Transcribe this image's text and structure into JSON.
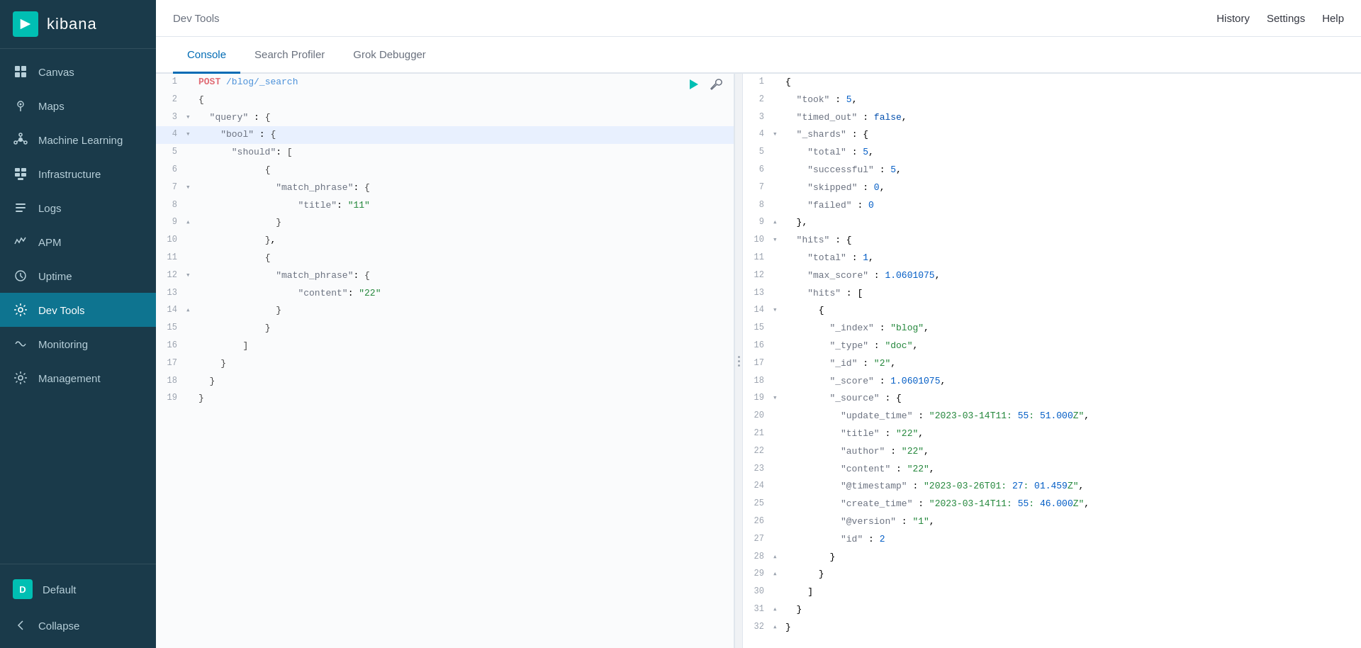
{
  "app": {
    "title": "kibana",
    "page_title": "Dev Tools"
  },
  "topbar": {
    "title": "Dev Tools",
    "actions": [
      "History",
      "Settings",
      "Help"
    ]
  },
  "tabs": [
    {
      "id": "console",
      "label": "Console",
      "active": true
    },
    {
      "id": "search-profiler",
      "label": "Search Profiler",
      "active": false
    },
    {
      "id": "grok-debugger",
      "label": "Grok Debugger",
      "active": false
    }
  ],
  "sidebar": {
    "items": [
      {
        "id": "canvas",
        "label": "Canvas",
        "icon": "⊞"
      },
      {
        "id": "maps",
        "label": "Maps",
        "icon": "◎"
      },
      {
        "id": "machine-learning",
        "label": "Machine Learning",
        "icon": "⚙"
      },
      {
        "id": "infrastructure",
        "label": "Infrastructure",
        "icon": "▦"
      },
      {
        "id": "logs",
        "label": "Logs",
        "icon": "☰"
      },
      {
        "id": "apm",
        "label": "APM",
        "icon": "◈"
      },
      {
        "id": "uptime",
        "label": "Uptime",
        "icon": "♡"
      },
      {
        "id": "dev-tools",
        "label": "Dev Tools",
        "icon": "⌘",
        "active": true
      },
      {
        "id": "monitoring",
        "label": "Monitoring",
        "icon": "♡"
      },
      {
        "id": "management",
        "label": "Management",
        "icon": "⚙"
      }
    ],
    "user": {
      "label": "Default",
      "initial": "D"
    },
    "collapse": "Collapse"
  },
  "query": {
    "lines": [
      {
        "num": 1,
        "fold": "",
        "content": "POST /blog/_search",
        "type": "header",
        "highlight": false
      },
      {
        "num": 2,
        "fold": "",
        "content": "{",
        "type": "bracket",
        "highlight": false
      },
      {
        "num": 3,
        "fold": "▾",
        "content": "  \"query\" : {",
        "type": "code",
        "highlight": false
      },
      {
        "num": 4,
        "fold": "▾",
        "content": "    \"bool\" : {",
        "type": "code",
        "highlight": true
      },
      {
        "num": 5,
        "fold": "",
        "content": "      \"should\": [",
        "type": "code",
        "highlight": false
      },
      {
        "num": 6,
        "fold": "",
        "content": "            {",
        "type": "code",
        "highlight": false
      },
      {
        "num": 7,
        "fold": "▾",
        "content": "              \"match_phrase\": {",
        "type": "code",
        "highlight": false
      },
      {
        "num": 8,
        "fold": "",
        "content": "                  \"title\": \"11\"",
        "type": "code",
        "highlight": false
      },
      {
        "num": 9,
        "fold": "▴",
        "content": "              }",
        "type": "code",
        "highlight": false
      },
      {
        "num": 10,
        "fold": "",
        "content": "            },",
        "type": "code",
        "highlight": false
      },
      {
        "num": 11,
        "fold": "",
        "content": "            {",
        "type": "code",
        "highlight": false
      },
      {
        "num": 12,
        "fold": "▾",
        "content": "              \"match_phrase\": {",
        "type": "code",
        "highlight": false
      },
      {
        "num": 13,
        "fold": "",
        "content": "                  \"content\": \"22\"",
        "type": "code",
        "highlight": false
      },
      {
        "num": 14,
        "fold": "▴",
        "content": "              }",
        "type": "code",
        "highlight": false
      },
      {
        "num": 15,
        "fold": "",
        "content": "            }",
        "type": "code",
        "highlight": false
      },
      {
        "num": 16,
        "fold": "",
        "content": "        ]",
        "type": "code",
        "highlight": false
      },
      {
        "num": 17,
        "fold": "",
        "content": "    }",
        "type": "code",
        "highlight": false
      },
      {
        "num": 18,
        "fold": "",
        "content": "  }",
        "type": "code",
        "highlight": false
      },
      {
        "num": 19,
        "fold": "",
        "content": "}",
        "type": "code",
        "highlight": false
      }
    ]
  },
  "result": {
    "lines": [
      {
        "num": 1,
        "fold": "",
        "content": "{"
      },
      {
        "num": 2,
        "fold": "",
        "content": "  \"took\" : 5,"
      },
      {
        "num": 3,
        "fold": "",
        "content": "  \"timed_out\" : false,"
      },
      {
        "num": 4,
        "fold": "▾",
        "content": "  \"_shards\" : {"
      },
      {
        "num": 5,
        "fold": "",
        "content": "    \"total\" : 5,"
      },
      {
        "num": 6,
        "fold": "",
        "content": "    \"successful\" : 5,"
      },
      {
        "num": 7,
        "fold": "",
        "content": "    \"skipped\" : 0,"
      },
      {
        "num": 8,
        "fold": "",
        "content": "    \"failed\" : 0"
      },
      {
        "num": 9,
        "fold": "▴",
        "content": "  },"
      },
      {
        "num": 10,
        "fold": "▾",
        "content": "  \"hits\" : {"
      },
      {
        "num": 11,
        "fold": "",
        "content": "    \"total\" : 1,"
      },
      {
        "num": 12,
        "fold": "",
        "content": "    \"max_score\" : 1.0601075,"
      },
      {
        "num": 13,
        "fold": "",
        "content": "    \"hits\" : ["
      },
      {
        "num": 14,
        "fold": "▾",
        "content": "      {"
      },
      {
        "num": 15,
        "fold": "",
        "content": "        \"_index\" : \"blog\","
      },
      {
        "num": 16,
        "fold": "",
        "content": "        \"_type\" : \"doc\","
      },
      {
        "num": 17,
        "fold": "",
        "content": "        \"_id\" : \"2\","
      },
      {
        "num": 18,
        "fold": "",
        "content": "        \"_score\" : 1.0601075,"
      },
      {
        "num": 19,
        "fold": "▾",
        "content": "        \"_source\" : {"
      },
      {
        "num": 20,
        "fold": "",
        "content": "          \"update_time\" : \"2023-03-14T11:55:51.000Z\","
      },
      {
        "num": 21,
        "fold": "",
        "content": "          \"title\" : \"22\","
      },
      {
        "num": 22,
        "fold": "",
        "content": "          \"author\" : \"22\","
      },
      {
        "num": 23,
        "fold": "",
        "content": "          \"content\" : \"22\","
      },
      {
        "num": 24,
        "fold": "",
        "content": "          \"@timestamp\" : \"2023-03-26T01:27:01.459Z\","
      },
      {
        "num": 25,
        "fold": "",
        "content": "          \"create_time\" : \"2023-03-14T11:55:46.000Z\","
      },
      {
        "num": 26,
        "fold": "",
        "content": "          \"@version\" : \"1\","
      },
      {
        "num": 27,
        "fold": "",
        "content": "          \"id\" : 2"
      },
      {
        "num": 28,
        "fold": "▴",
        "content": "        }"
      },
      {
        "num": 29,
        "fold": "▴",
        "content": "      }"
      },
      {
        "num": 30,
        "fold": "",
        "content": "    ]"
      },
      {
        "num": 31,
        "fold": "▴",
        "content": "  }"
      },
      {
        "num": 32,
        "fold": "▴",
        "content": "}"
      }
    ]
  }
}
